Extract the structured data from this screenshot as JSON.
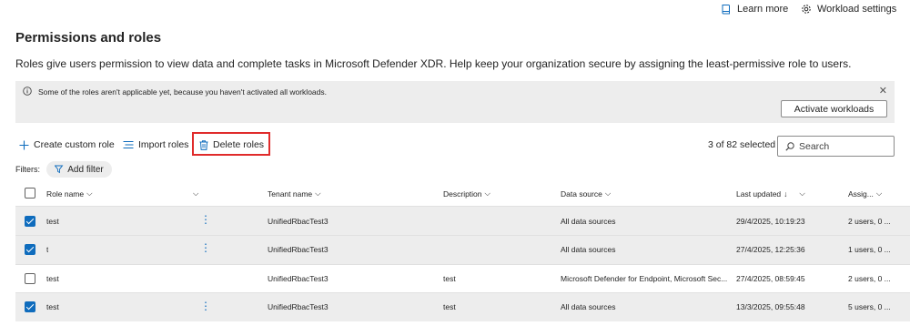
{
  "header": {
    "learn_more": "Learn more",
    "workload_settings": "Workload settings",
    "title": "Permissions and roles",
    "description": "Roles give users permission to view data and complete tasks in Microsoft Defender XDR. Help keep your organization secure by assigning the least-permissive role to users."
  },
  "banner": {
    "message": "Some of the roles aren't applicable yet, because you haven't activated all workloads.",
    "activate_label": "Activate workloads"
  },
  "toolbar": {
    "create_label": "Create custom role",
    "import_label": "Import roles",
    "delete_label": "Delete roles",
    "selected_text": "3 of 82 selected",
    "search_placeholder": "Search"
  },
  "filters": {
    "label": "Filters:",
    "add_filter": "Add filter"
  },
  "table": {
    "columns": {
      "role_name": "Role name",
      "tenant_name": "Tenant name",
      "description": "Description",
      "data_source": "Data source",
      "last_updated": "Last updated",
      "assignments": "Assig..."
    },
    "rows": [
      {
        "selected": true,
        "role_name": "test",
        "tenant": "UnifiedRbacTest3",
        "description": "",
        "data_source": "All data sources",
        "last_updated": "29/4/2025, 10:19:23",
        "assignments": "2 users, 0 ..."
      },
      {
        "selected": true,
        "role_name": "t",
        "tenant": "UnifiedRbacTest3",
        "description": "",
        "data_source": "All data sources",
        "last_updated": "27/4/2025, 12:25:36",
        "assignments": "1 users, 0 ..."
      },
      {
        "selected": false,
        "role_name": "test",
        "tenant": "UnifiedRbacTest3",
        "description": "test",
        "data_source": "Microsoft Defender for Endpoint, Microsoft Sec...",
        "last_updated": "27/4/2025, 08:59:45",
        "assignments": "2 users, 0 ..."
      },
      {
        "selected": true,
        "role_name": "test",
        "tenant": "UnifiedRbacTest3",
        "description": "test",
        "data_source": "All data sources",
        "last_updated": "13/3/2025, 09:55:48",
        "assignments": "5 users, 0 ..."
      }
    ]
  },
  "colors": {
    "accent": "#0f6cbd",
    "selected_row": "#ededed",
    "highlight": "#e02b2b"
  }
}
